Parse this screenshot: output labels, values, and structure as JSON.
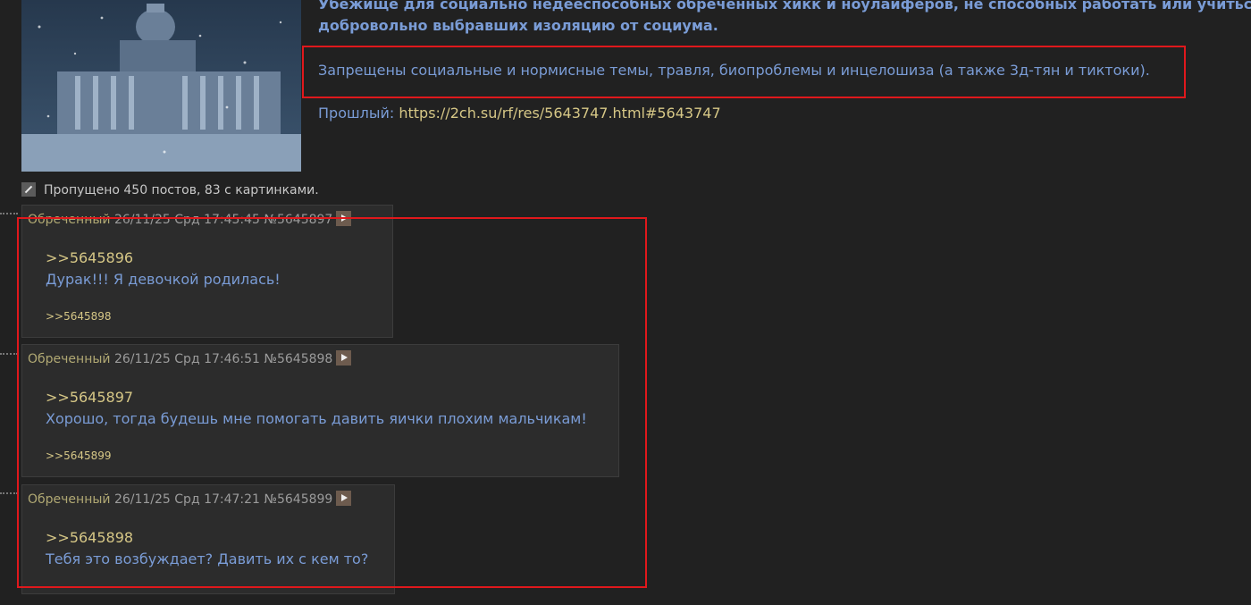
{
  "op": {
    "line1": "Убежище для социально недееспособных обреченных хикк и ноулайферов, не способных работать или учиться",
    "line2": "добровольно выбравших изоляцию от социума.",
    "rules": "Запрещены социальные и нормисные темы, травля, биопроблемы и инцелошиза (а также 3д-тян и тиктоки).",
    "prev_label": "Прошлый: ",
    "prev_link": "https://2ch.su/rf/res/5643747.html#5643747"
  },
  "skipped": "Пропущено 450 постов, 83 с картинками.",
  "posts": [
    {
      "name": "Обреченный",
      "date": "26/11/25 Срд 17:45:45",
      "num": "№5645897",
      "reply_to": ">>5645896",
      "text": "Дурак!!! Я девочкой родилась!",
      "answers": ">>5645898"
    },
    {
      "name": "Обреченный",
      "date": "26/11/25 Срд 17:46:51",
      "num": "№5645898",
      "reply_to": ">>5645897",
      "text": "Хорошо, тогда будешь мне помогать давить яички плохим мальчикам!",
      "answers": ">>5645899"
    },
    {
      "name": "Обреченный",
      "date": "26/11/25 Срд 17:47:21",
      "num": "№5645899",
      "reply_to": ">>5645898",
      "text": "Тебя это возбуждает? Давить их с кем то?",
      "answers": ""
    }
  ],
  "icons": {
    "expand": "expand-icon",
    "play": "play-icon"
  },
  "colors": {
    "background": "#212121",
    "post_bg": "#2c2c2c",
    "text": "#7a9cd6",
    "link": "#d6c786",
    "highlight_box": "#e0181c"
  }
}
